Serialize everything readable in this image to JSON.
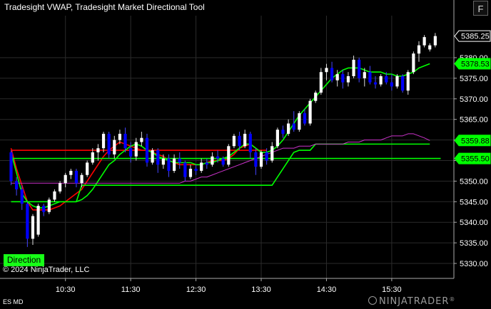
{
  "window": {
    "title": "Tradesight VWAP, Tradesight Market Directional Tool",
    "f_button": "F"
  },
  "direction_button": "Direction",
  "copyright": "© 2024 NinjaTrader, LLC",
  "instrument_label": "ES MD",
  "brand": {
    "prefix": "NINJA",
    "suffix": "TRADER",
    "mark": "®"
  },
  "chart_data": {
    "type": "candlestick",
    "y_ticks": [
      5330,
      5335,
      5340,
      5345,
      5350,
      5355,
      5360,
      5365,
      5370,
      5375,
      5380
    ],
    "y_tick_labels": [
      "5330.00",
      "5335.00",
      "5340.00",
      "5345.00",
      "5350.00",
      "5355.00",
      "5360.00",
      "5365.00",
      "5370.00",
      "5375.00",
      "5380.00"
    ],
    "ylim": [
      5327.5,
      5387.5
    ],
    "x_tick_labels": [
      "10:30",
      "11:30",
      "12:30",
      "13:30",
      "14:30",
      "15:30"
    ],
    "x_tick_bars": [
      10,
      22,
      34,
      46,
      58,
      70
    ],
    "grid": true,
    "colors": {
      "up": "#ffffff",
      "down": "#0000ff",
      "background": "#000000",
      "grid": "#2b2b2b",
      "green": "#00ff00",
      "red": "#ff0000",
      "magenta": "#cc33cc"
    },
    "price_labels": [
      {
        "text": "5385.25",
        "value": 5385.25,
        "style": "current"
      },
      {
        "text": "5378.53",
        "value": 5378.53,
        "style": "green"
      },
      {
        "text": "5359.88",
        "value": 5359.88,
        "style": "green"
      },
      {
        "text": "5355.50",
        "value": 5355.5,
        "style": "green"
      }
    ],
    "candles": [
      [
        5357.0,
        5357.5,
        5349.0,
        5350.0
      ],
      [
        5350.0,
        5351.0,
        5346.5,
        5348.0
      ],
      [
        5348.0,
        5349.0,
        5343.0,
        5344.5
      ],
      [
        5344.5,
        5345.0,
        5334.0,
        5336.0
      ],
      [
        5336.0,
        5342.0,
        5334.5,
        5341.5
      ],
      [
        5337.0,
        5344.5,
        5336.5,
        5344.0
      ],
      [
        5344.0,
        5344.5,
        5341.5,
        5342.5
      ],
      [
        5342.5,
        5346.0,
        5342.0,
        5345.5
      ],
      [
        5345.5,
        5348.0,
        5345.0,
        5347.5
      ],
      [
        5347.5,
        5350.0,
        5347.0,
        5349.5
      ],
      [
        5349.5,
        5352.0,
        5348.5,
        5351.5
      ],
      [
        5351.5,
        5353.0,
        5350.5,
        5352.5
      ],
      [
        5352.5,
        5353.0,
        5348.5,
        5349.5
      ],
      [
        5349.5,
        5352.0,
        5348.5,
        5351.5
      ],
      [
        5351.5,
        5355.0,
        5351.0,
        5354.5
      ],
      [
        5354.5,
        5358.0,
        5354.0,
        5357.0
      ],
      [
        5357.0,
        5359.0,
        5355.0,
        5358.0
      ],
      [
        5358.0,
        5362.0,
        5357.0,
        5361.5
      ],
      [
        5361.5,
        5362.0,
        5355.5,
        5356.5
      ],
      [
        5356.5,
        5361.0,
        5355.5,
        5360.0
      ],
      [
        5360.0,
        5362.5,
        5359.0,
        5361.5
      ],
      [
        5361.5,
        5363.0,
        5357.0,
        5358.0
      ],
      [
        5358.0,
        5359.5,
        5354.5,
        5356.0
      ],
      [
        5356.0,
        5360.5,
        5355.0,
        5359.5
      ],
      [
        5359.5,
        5362.0,
        5358.5,
        5360.5
      ],
      [
        5360.5,
        5361.5,
        5353.5,
        5354.5
      ],
      [
        5354.5,
        5358.0,
        5354.0,
        5357.5
      ],
      [
        5357.5,
        5358.0,
        5352.0,
        5354.0
      ],
      [
        5354.0,
        5356.5,
        5353.0,
        5355.5
      ],
      [
        5355.5,
        5356.5,
        5351.0,
        5352.5
      ],
      [
        5352.5,
        5356.5,
        5352.0,
        5355.5
      ],
      [
        5355.5,
        5357.0,
        5353.0,
        5354.5
      ],
      [
        5354.5,
        5355.0,
        5350.0,
        5351.0
      ],
      [
        5351.0,
        5354.0,
        5350.5,
        5353.0
      ],
      [
        5353.0,
        5354.0,
        5351.5,
        5352.5
      ],
      [
        5352.5,
        5355.5,
        5352.0,
        5354.5
      ],
      [
        5354.5,
        5355.5,
        5353.0,
        5354.0
      ],
      [
        5354.0,
        5357.0,
        5353.5,
        5356.0
      ],
      [
        5356.0,
        5357.5,
        5354.5,
        5355.5
      ],
      [
        5355.5,
        5356.0,
        5353.5,
        5354.0
      ],
      [
        5354.0,
        5359.0,
        5353.5,
        5358.5
      ],
      [
        5358.5,
        5361.5,
        5358.0,
        5361.0
      ],
      [
        5361.0,
        5362.0,
        5357.5,
        5358.5
      ],
      [
        5358.5,
        5362.5,
        5358.0,
        5361.5
      ],
      [
        5361.5,
        5362.0,
        5355.5,
        5357.0
      ],
      [
        5357.0,
        5358.0,
        5351.5,
        5353.5
      ],
      [
        5353.5,
        5357.5,
        5353.0,
        5357.0
      ],
      [
        5357.0,
        5358.0,
        5354.0,
        5355.0
      ],
      [
        5355.0,
        5359.5,
        5354.5,
        5358.5
      ],
      [
        5358.5,
        5363.0,
        5358.0,
        5362.5
      ],
      [
        5362.5,
        5363.5,
        5360.5,
        5361.5
      ],
      [
        5361.5,
        5365.0,
        5361.0,
        5364.0
      ],
      [
        5364.0,
        5367.0,
        5362.0,
        5362.5
      ],
      [
        5362.5,
        5367.0,
        5362.0,
        5366.5
      ],
      [
        5366.5,
        5367.5,
        5363.5,
        5364.0
      ],
      [
        5364.0,
        5370.0,
        5363.5,
        5369.5
      ],
      [
        5369.5,
        5372.0,
        5369.0,
        5371.5
      ],
      [
        5371.5,
        5377.5,
        5371.0,
        5376.5
      ],
      [
        5376.5,
        5378.5,
        5374.5,
        5377.5
      ],
      [
        5377.5,
        5379.0,
        5374.0,
        5374.5
      ],
      [
        5374.5,
        5377.0,
        5373.0,
        5376.0
      ],
      [
        5376.0,
        5377.0,
        5372.5,
        5374.0
      ],
      [
        5374.0,
        5376.5,
        5373.0,
        5375.5
      ],
      [
        5375.5,
        5380.5,
        5375.0,
        5379.5
      ],
      [
        5379.5,
        5380.0,
        5374.0,
        5375.0
      ],
      [
        5375.0,
        5377.5,
        5373.0,
        5376.5
      ],
      [
        5376.5,
        5378.0,
        5373.5,
        5374.0
      ],
      [
        5374.0,
        5375.5,
        5372.5,
        5373.5
      ],
      [
        5373.5,
        5376.0,
        5373.0,
        5375.5
      ],
      [
        5375.5,
        5376.5,
        5373.5,
        5374.0
      ],
      [
        5374.0,
        5376.0,
        5372.0,
        5373.0
      ],
      [
        5373.0,
        5376.0,
        5372.5,
        5375.5
      ],
      [
        5375.5,
        5376.0,
        5371.5,
        5372.0
      ],
      [
        5372.0,
        5377.0,
        5371.0,
        5376.5
      ],
      [
        5376.5,
        5381.5,
        5376.0,
        5381.0
      ],
      [
        5381.0,
        5384.0,
        5379.0,
        5383.0
      ],
      [
        5383.0,
        5385.5,
        5382.5,
        5385.0
      ],
      [
        5382.0,
        5383.5,
        5381.5,
        5383.0
      ],
      [
        5383.0,
        5386.0,
        5382.5,
        5385.25
      ]
    ],
    "series": [
      {
        "color": "#ff0000",
        "values": [
          5358.0,
          5353.0,
          5349.0,
          5345.0,
          5343.0,
          5343.0,
          5343.0,
          5343.0,
          5343.5,
          5344.0,
          5345.0,
          5346.0,
          5347.0,
          5348.0,
          5350.0,
          5352.0,
          5354.0,
          5356.0,
          5357.5,
          5358.5,
          5359.5,
          5359.0,
          5358.5,
          5358.0,
          5357.5,
          5357.5,
          5357.0,
          5356.5,
          5356.0,
          5355.0,
          5354.5,
          5354.0,
          5354.0,
          5354.0,
          5354.0,
          5354.0,
          5354.5,
          5355.0,
          5355.0,
          5355.0,
          5355.5,
          5356.5,
          5358.0,
          5358.5,
          5359.0,
          5358.0,
          5357.0
        ]
      },
      {
        "color": "#ff0000",
        "values": [
          5357.5,
          5357.5,
          5357.5,
          5357.5,
          5357.5,
          5357.5,
          5357.5,
          5357.5,
          5357.5,
          5357.5,
          5357.5,
          5357.5,
          5357.5,
          5357.5,
          5357.5,
          5357.5,
          5357.5,
          5357.5,
          5357.5,
          5357.5,
          5357.5,
          5357.5,
          5357.5,
          5357.5,
          5357.5,
          5357.5,
          5357.5,
          5357.5,
          5357.5,
          5357.5,
          5357.5,
          5357.5,
          5357.5,
          5357.5,
          5357.5,
          5357.5,
          5357.5,
          5357.5,
          5357.5,
          5357.5,
          5357.5,
          5357.5,
          5357.5,
          5357.5,
          5357.5,
          5357.5,
          5357.5,
          5357.5
        ]
      },
      {
        "color": "#00ff00",
        "values": [
          5357.0,
          5352.0,
          5347.0,
          5345.0,
          5344.0,
          5343.5,
          5343.5,
          5344.0,
          5344.5,
          5345.0,
          5345.0,
          5345.0,
          5345.0,
          5345.5,
          5346.5,
          5348.0,
          5350.0,
          5352.0,
          5354.0,
          5355.0,
          5356.5,
          5357.5,
          5358.5,
          5359.0,
          5358.5,
          5357.5,
          5357.0,
          5356.0,
          5355.5,
          5355.0,
          5354.5,
          5354.5,
          5354.5,
          5354.5,
          5354.0,
          5354.0,
          5354.5,
          5354.5,
          5355.0,
          5355.5,
          5356.0,
          5357.0,
          5358.0,
          5359.0,
          5359.0,
          5358.0,
          5357.0,
          5357.0,
          5357.5,
          5358.5,
          5360.0,
          5362.0,
          5364.0,
          5366.0,
          5367.5,
          5369.0,
          5370.5,
          5372.0,
          5373.5,
          5375.0,
          5376.0,
          5377.0,
          5377.5,
          5377.5,
          5377.5,
          5377.0,
          5376.5,
          5376.5,
          5376.5,
          5376.0,
          5376.0,
          5375.5,
          5375.5,
          5376.0,
          5376.5,
          5377.5,
          5378.0,
          5378.53
        ]
      },
      {
        "color": "#00ff00",
        "values": [
          5345.0,
          5345.0,
          5345.0,
          5345.0,
          5345.0,
          5345.0,
          5345.0,
          5345.0,
          5345.0,
          5345.0,
          5345.0,
          5345.0,
          5345.0,
          5349.0,
          5349.0,
          5349.0,
          5349.0,
          5349.0,
          5349.0,
          5349.0,
          5349.0,
          5349.0,
          5349.0,
          5349.0,
          5349.0,
          5349.0,
          5349.0,
          5349.0,
          5349.0,
          5349.0,
          5349.0,
          5349.0,
          5349.0,
          5349.0,
          5349.0,
          5349.0,
          5349.0,
          5349.0,
          5349.0,
          5349.0,
          5349.0,
          5349.0,
          5349.0,
          5349.0,
          5349.0,
          5349.0,
          5349.0,
          5349.0,
          5349.0,
          5351.0,
          5353.0,
          5355.0,
          5357.0,
          5357.5,
          5357.5,
          5357.5,
          5359.0,
          5359.0,
          5359.0,
          5359.0,
          5359.0,
          5359.0,
          5359.0,
          5359.0,
          5359.0,
          5359.0,
          5359.0,
          5359.0,
          5359.0,
          5359.0,
          5359.0,
          5359.0,
          5359.0,
          5359.0,
          5359.0,
          5359.0,
          5359.0,
          5359.0
        ]
      },
      {
        "color": "#00ff00",
        "values": [
          5355.5,
          5355.5
        ]
      },
      {
        "color": "#cc33cc",
        "values": [
          5349.5,
          5349.5,
          5349.5,
          5349.5,
          5349.5,
          5349.5,
          5349.5,
          5349.5,
          5349.5,
          5349.5,
          5349.5,
          5349.5,
          5349.5,
          5349.5,
          5349.5,
          5349.5,
          5349.5,
          5349.5,
          5349.5,
          5349.5,
          5349.5,
          5349.5,
          5349.5,
          5349.5,
          5349.5,
          5349.5,
          5349.5,
          5349.5,
          5349.5,
          5349.5,
          5349.5,
          5349.5,
          5350.0,
          5350.0,
          5350.5,
          5351.0,
          5351.0,
          5351.5,
          5352.0,
          5352.5,
          5353.0,
          5353.5,
          5354.0,
          5354.5,
          5355.0,
          5355.5,
          5356.0,
          5356.5,
          5357.0,
          5357.5,
          5358.0,
          5358.0,
          5358.0,
          5358.5,
          5358.5,
          5358.5,
          5359.0,
          5359.0,
          5359.0,
          5359.0,
          5359.0,
          5359.0,
          5359.5,
          5359.5,
          5359.5,
          5360.0,
          5360.0,
          5360.0,
          5360.0,
          5360.5,
          5361.0,
          5361.0,
          5361.0,
          5361.5,
          5361.5,
          5361.0,
          5360.5,
          5359.88
        ]
      }
    ]
  }
}
